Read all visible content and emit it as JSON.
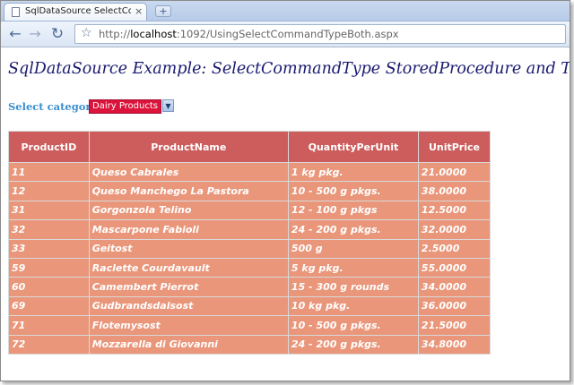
{
  "browser": {
    "tab_title": "SqlDataSource SelectComm…",
    "tab_close": "×",
    "new_tab": "+",
    "url_prefix": "http://",
    "url_host": "localhost",
    "url_rest": ":1092/UsingSelectCommandTypeBoth.aspx",
    "icons": [
      "page-icon",
      "back-arrow-icon",
      "forward-arrow-icon",
      "reload-icon",
      "star-icon"
    ]
  },
  "page": {
    "heading": "SqlDataSource Example: SelectCommandType StoredProcedure and Text",
    "select_label": "Select category",
    "select_value": "Dairy Products"
  },
  "grid": {
    "headers": [
      "ProductID",
      "ProductName",
      "QuantityPerUnit",
      "UnitPrice"
    ],
    "rows": [
      [
        "11",
        "Queso Cabrales",
        "1 kg pkg.",
        "21.0000"
      ],
      [
        "12",
        "Queso Manchego La Pastora",
        "10 - 500 g pkgs.",
        "38.0000"
      ],
      [
        "31",
        "Gorgonzola Telino",
        "12 - 100 g pkgs",
        "12.5000"
      ],
      [
        "32",
        "Mascarpone Fabioli",
        "24 - 200 g pkgs.",
        "32.0000"
      ],
      [
        "33",
        "Geitost",
        "500 g",
        "2.5000"
      ],
      [
        "59",
        "Raclette Courdavault",
        "5 kg pkg.",
        "55.0000"
      ],
      [
        "60",
        "Camembert Pierrot",
        "15 - 300 g rounds",
        "34.0000"
      ],
      [
        "69",
        "Gudbrandsdalsost",
        "10 kg pkg.",
        "36.0000"
      ],
      [
        "71",
        "Flotemysost",
        "10 - 500 g pkgs.",
        "21.5000"
      ],
      [
        "72",
        "Mozzarella di Giovanni",
        "24 - 200 g pkgs.",
        "34.8000"
      ]
    ]
  },
  "colors": {
    "header_bg": "#cd5c5c",
    "row_bg": "#e9967a",
    "heading": "#191970",
    "select_bg": "#dc143c"
  }
}
